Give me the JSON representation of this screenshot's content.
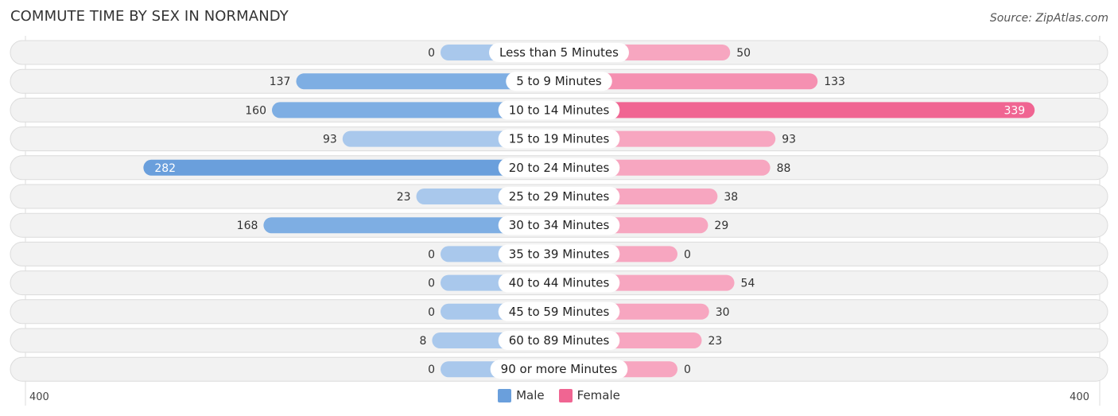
{
  "title": "COMMUTE TIME BY SEX IN NORMANDY",
  "source": "Source: ZipAtlas.com",
  "colors": {
    "male": "#6a9fdc",
    "male_light": "#a9c8ec",
    "female": "#f06592",
    "female_light": "#f7a6c0",
    "track": "#f2f2f2"
  },
  "legend": [
    {
      "label": "Male",
      "color": "#6a9fdc"
    },
    {
      "label": "Female",
      "color": "#f06592"
    }
  ],
  "chart_data": {
    "type": "bar",
    "orientation": "horizontal-diverging",
    "title": "COMMUTE TIME BY SEX IN NORMANDY",
    "categories": [
      "Less than 5 Minutes",
      "5 to 9 Minutes",
      "10 to 14 Minutes",
      "15 to 19 Minutes",
      "20 to 24 Minutes",
      "25 to 29 Minutes",
      "30 to 34 Minutes",
      "35 to 39 Minutes",
      "40 to 44 Minutes",
      "45 to 59 Minutes",
      "60 to 89 Minutes",
      "90 or more Minutes"
    ],
    "series": [
      {
        "name": "Male",
        "values": [
          0,
          137,
          160,
          93,
          282,
          23,
          168,
          0,
          0,
          0,
          8,
          0
        ]
      },
      {
        "name": "Female",
        "values": [
          50,
          133,
          339,
          93,
          88,
          38,
          29,
          0,
          54,
          30,
          23,
          0
        ]
      }
    ],
    "axis_min_label": "400",
    "axis_max_label": "400",
    "xlim": [
      -400,
      400
    ],
    "legend_position": "bottom-center"
  }
}
